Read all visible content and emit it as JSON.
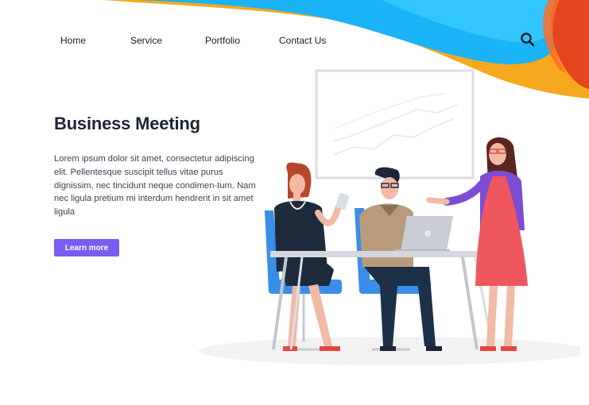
{
  "nav": {
    "items": [
      "Home",
      "Service",
      "Portfolio",
      "Contact Us"
    ],
    "search_icon": "search-icon"
  },
  "hero": {
    "title": "Business Meeting",
    "description": "Lorem ipsum dolor sit amet, consectetur adipiscing elit. Pellentesque suscipit tellus vitae purus dignissim, nec tincidunt neque condimen-tum. Nam nec ligula pretium mi interdum hendrerit in sit amet ligula",
    "button_label": "Learn more"
  },
  "colors": {
    "accent": "#7a5cf0",
    "wave_blue": "#1fb6ff",
    "wave_orange": "#f5a623",
    "wave_red": "#e3401c",
    "chair_blue": "#3a8ee8"
  }
}
